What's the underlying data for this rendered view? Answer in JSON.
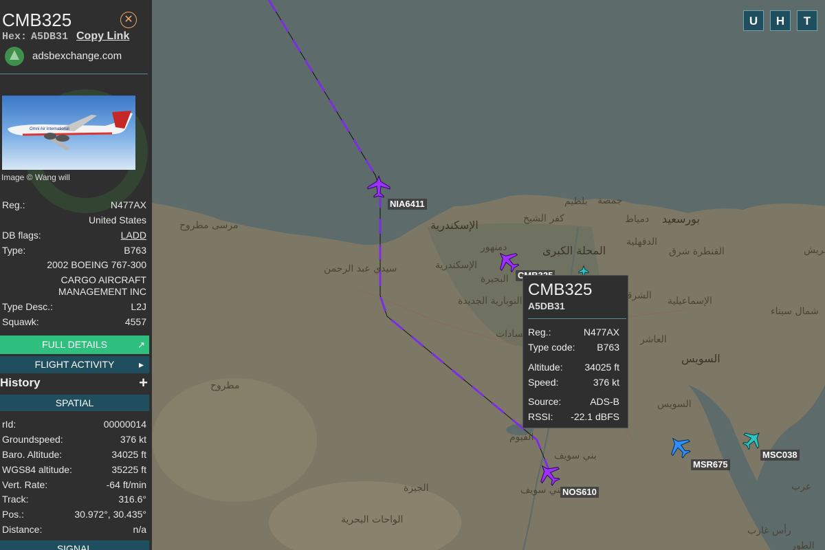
{
  "sidebar": {
    "callsign": "CMB325",
    "hex_label": "Hex:",
    "hex_value": "A5DB31",
    "copy_link": "Copy Link",
    "source": "adsbexchange.com",
    "photo_credit": "Image © Wang will",
    "details": [
      {
        "label": "Reg.:",
        "value": "N477AX"
      },
      {
        "label": "",
        "value": "United States"
      },
      {
        "label": "DB flags:",
        "value": "LADD"
      },
      {
        "label": "Type:",
        "value": "B763"
      },
      {
        "label": "",
        "value": "2002 BOEING 767-300"
      },
      {
        "label": "",
        "value": "CARGO AIRCRAFT"
      },
      {
        "label": "",
        "value": "MANAGEMENT INC"
      },
      {
        "label": "Type Desc.:",
        "value": "L2J"
      },
      {
        "label": "Squawk:",
        "value": "4557"
      }
    ],
    "full_details": "FULL DETAILS",
    "flight_activity": "FLIGHT ACTIVITY",
    "history": "History",
    "spatial": "SPATIAL",
    "spatial_rows": [
      {
        "label": "rId:",
        "value": "00000014"
      },
      {
        "label": "Groundspeed:",
        "value": "376 kt"
      },
      {
        "label": "Baro. Altitude:",
        "value": "34025 ft"
      },
      {
        "label": "WGS84 altitude:",
        "value": "35225 ft"
      },
      {
        "label": "Vert. Rate:",
        "value": "-64 ft/min"
      },
      {
        "label": "Track:",
        "value": "316.6°"
      },
      {
        "label": "Pos.:",
        "value": "30.972°, 30.435°"
      },
      {
        "label": "Distance:",
        "value": "n/a"
      }
    ],
    "signal": "SIGNAL"
  },
  "map": {
    "buttons": [
      "U",
      "H",
      "T"
    ],
    "aircraft": [
      {
        "callsign": "NIA6411",
        "color": "#9b30ff"
      },
      {
        "callsign": "CMB325",
        "color": "#9b30ff"
      },
      {
        "callsign": "NOS610",
        "color": "#9b30ff"
      },
      {
        "callsign": "MSR675",
        "color": "#2f8fff"
      },
      {
        "callsign": "MSC038",
        "color": "#2ec4c4"
      }
    ],
    "cities": [
      "الإسكندرية",
      "مرسى مطروح",
      "سيدي عبد الرحمن",
      "الإسكندرية",
      "دمنهور",
      "البحيرة",
      "النوبارية الجديدة",
      "السادات",
      "المحلة الكبرى",
      "كفر الشيخ",
      "بلطيم",
      "جمصة",
      "دمياط",
      "بورسعيد",
      "الدقهلية",
      "القنطرة شرق",
      "الإسماعيلية",
      "شمال سيناء",
      "العاشر",
      "السويس",
      "السويس",
      "مطروح",
      "الفيوم",
      "بني سويف",
      "بني سويف",
      "الجيزة",
      "الواحات البحرية",
      "رأس غارب",
      "الطور",
      "عريش",
      "عرب",
      "الشرقية"
    ]
  },
  "tooltip": {
    "callsign": "CMB325",
    "hex": "A5DB31",
    "rows": [
      {
        "label": "Reg.:",
        "value": "N477AX"
      },
      {
        "label": "Type code:",
        "value": "B763"
      },
      {
        "label": "Altitude:",
        "value": "34025 ft"
      },
      {
        "label": "Speed:",
        "value": "376 kt"
      },
      {
        "label": "Source:",
        "value": "ADS-B"
      },
      {
        "label": "RSSI:",
        "value": "-22.1 dBFS"
      }
    ]
  }
}
